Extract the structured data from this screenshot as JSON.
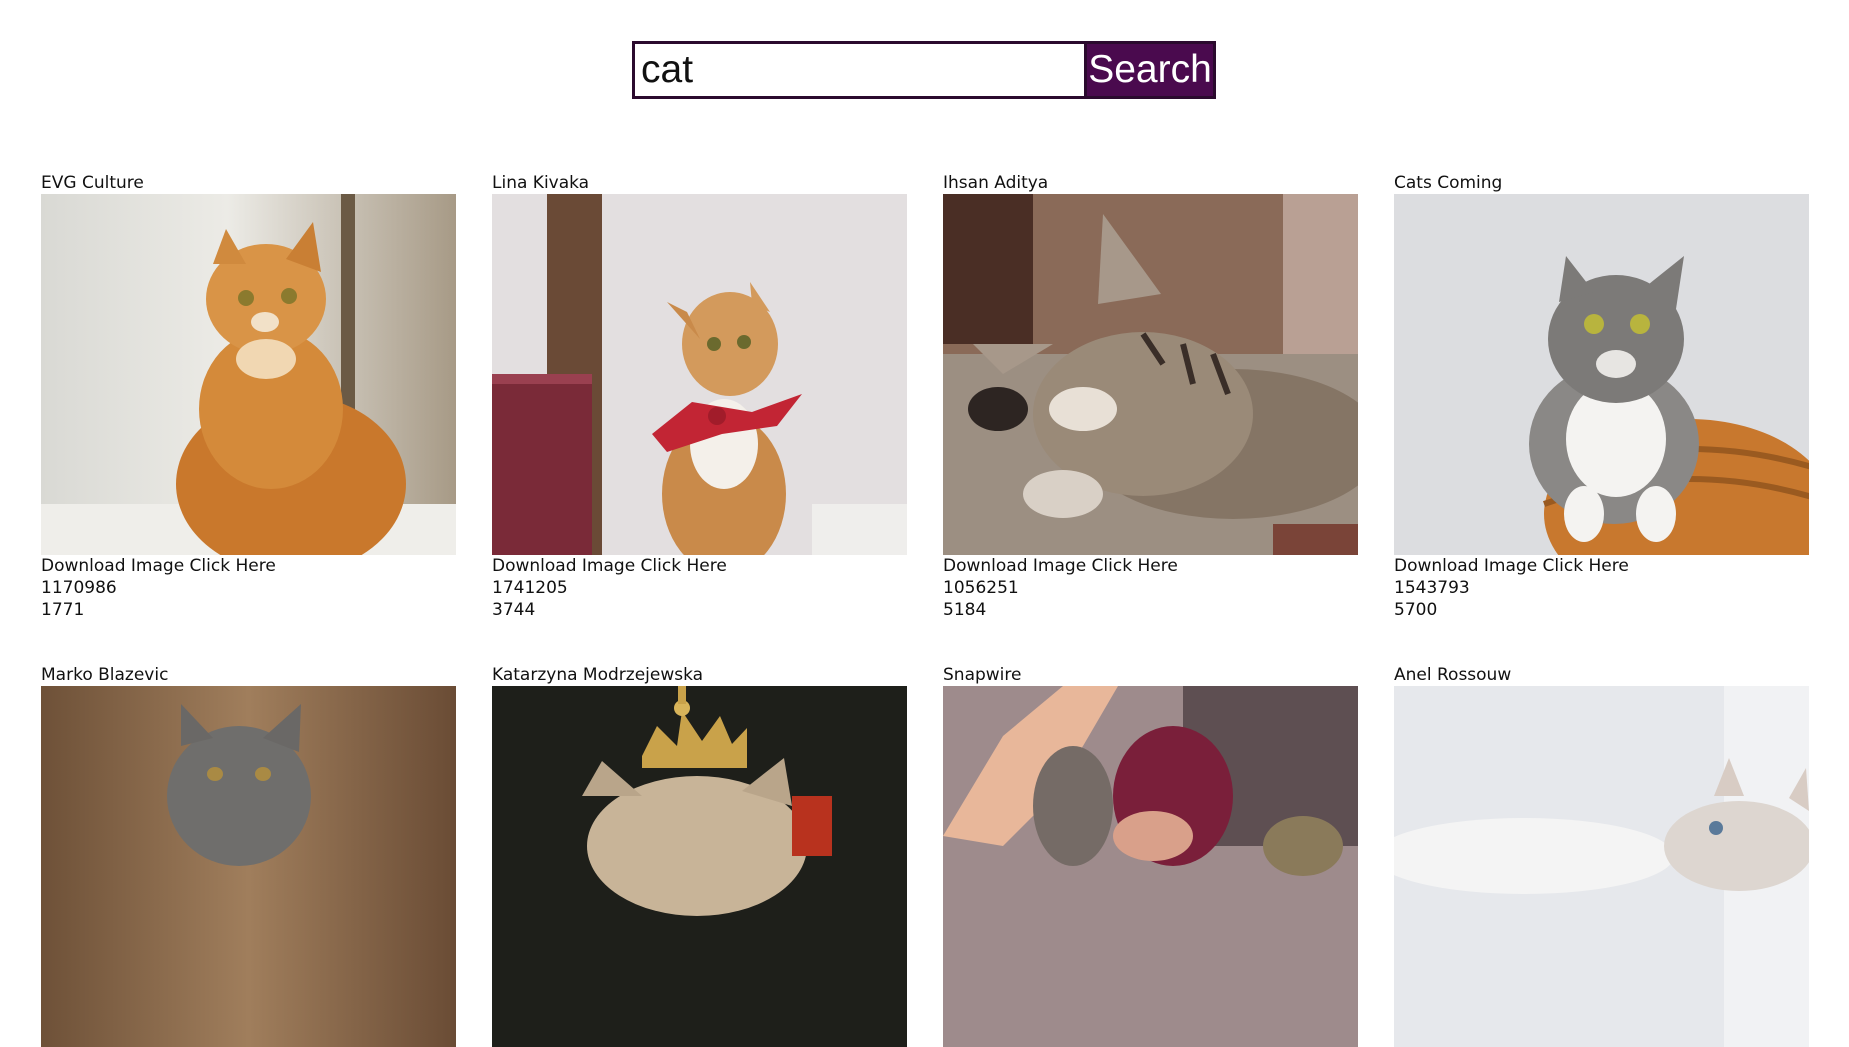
{
  "search": {
    "value": "cat",
    "button_label": "Search"
  },
  "results": [
    {
      "author": "EVG Culture",
      "download_label": "Download Image Click Here",
      "id": "1170986",
      "count": "1771"
    },
    {
      "author": "Lina Kivaka",
      "download_label": "Download Image Click Here",
      "id": "1741205",
      "count": "3744"
    },
    {
      "author": "Ihsan Aditya",
      "download_label": "Download Image Click Here",
      "id": "1056251",
      "count": "5184"
    },
    {
      "author": "Cats Coming",
      "download_label": "Download Image Click Here",
      "id": "1543793",
      "count": "5700"
    },
    {
      "author": "Marko Blazevic"
    },
    {
      "author": "Katarzyna Modrzejewska"
    },
    {
      "author": "Snapwire"
    },
    {
      "author": "Anel Rossouw"
    }
  ],
  "colors": {
    "search_button_bg": "#4a0a4e",
    "search_border": "#2b0a2e"
  }
}
